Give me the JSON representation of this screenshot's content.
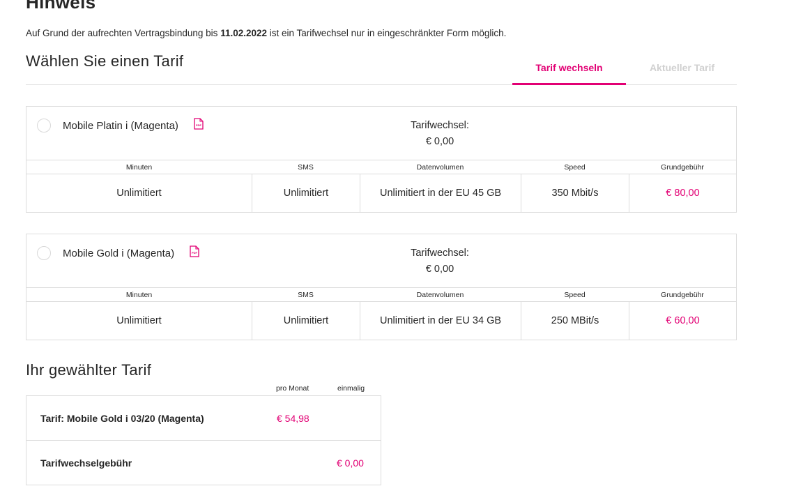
{
  "notice": {
    "title": "Hinweis",
    "text_before": "Auf Grund der aufrechten Vertragsbindung bis ",
    "date": "11.02.2022",
    "text_after": " ist ein Tarifwechsel nur in eingeschränkter Form möglich."
  },
  "tariff_section": {
    "heading": "Wählen Sie einen Tarif",
    "tabs": [
      {
        "label": "Tarif wechseln",
        "active": true
      },
      {
        "label": "Aktueller Tarif",
        "active": false
      }
    ]
  },
  "column_headers": [
    "Minuten",
    "SMS",
    "Datenvolumen",
    "Speed",
    "Grundgebühr"
  ],
  "plans": [
    {
      "name": "Mobile Platin i (Magenta)",
      "change_label": "Tarifwechsel:",
      "change_fee": "€ 0,00",
      "minutes": "Unlimitiert",
      "sms": "Unlimitiert",
      "data": "Unlimitiert in der EU 45 GB",
      "speed": "350 Mbit/s",
      "base_fee": "€ 80,00"
    },
    {
      "name": "Mobile Gold i (Magenta)",
      "change_label": "Tarifwechsel:",
      "change_fee": "€ 0,00",
      "minutes": "Unlimitiert",
      "sms": "Unlimitiert",
      "data": "Unlimitiert in der EU 34 GB",
      "speed": "250 MBit/s",
      "base_fee": "€ 60,00"
    }
  ],
  "selected": {
    "heading": "Ihr gewählter Tarif",
    "col_month": "pro Monat",
    "col_once": "einmalig",
    "rows": [
      {
        "label": "Tarif: Mobile Gold i 03/20 (Magenta)",
        "month": "€ 54,98",
        "once": ""
      },
      {
        "label": "Tarifwechselgebühr",
        "month": "",
        "once": "€ 0,00"
      }
    ]
  },
  "colors": {
    "accent": "#e20074",
    "border": "#dcdcdc",
    "text": "#262626",
    "tab_inactive": "#d0d0d0"
  },
  "icons": {
    "plan_document": "pdf-icon",
    "plan_select": "radio-button"
  }
}
